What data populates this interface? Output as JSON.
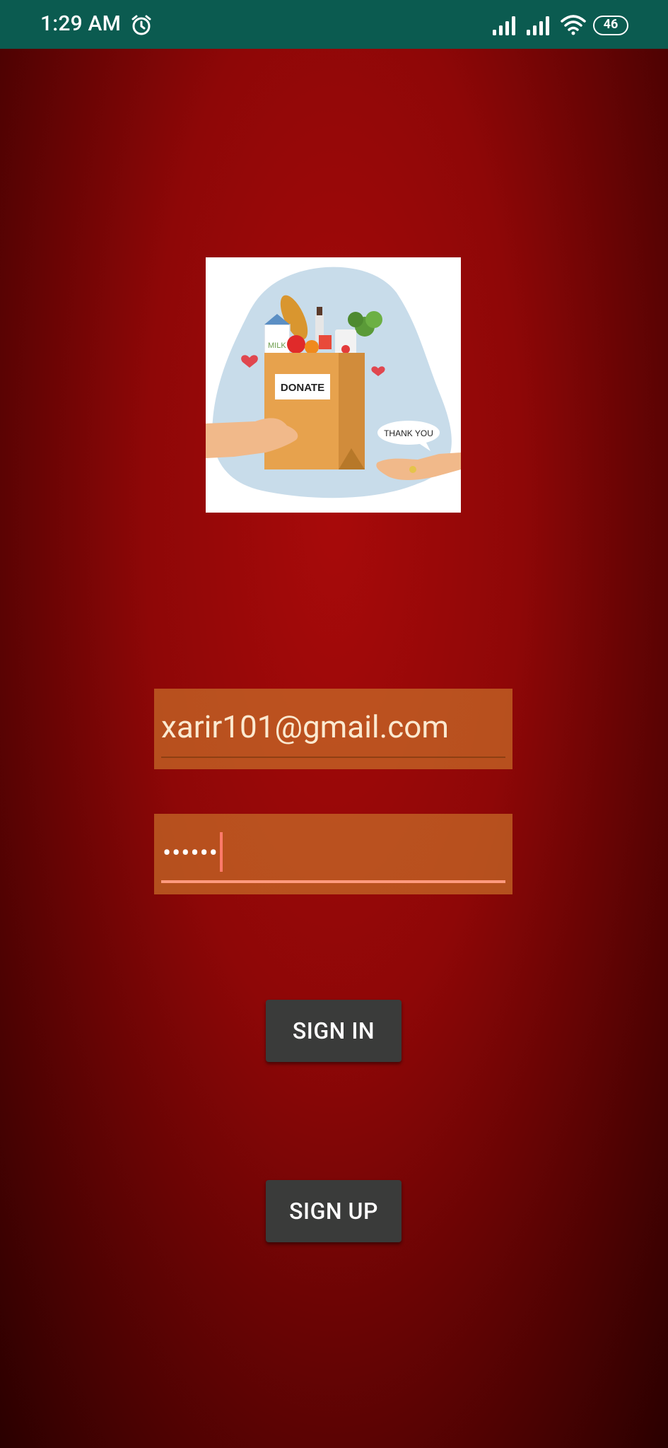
{
  "status_bar": {
    "time": "1:29 AM",
    "battery": "46",
    "icons": [
      "alarm-icon",
      "signal-icon",
      "signal-icon",
      "wifi-icon",
      "battery-icon"
    ]
  },
  "logo": {
    "icon": "donation-illustration",
    "bag_label": "DONATE",
    "speech_bubble": "THANK YOU",
    "milk_label": "MILK"
  },
  "login_form": {
    "email_value": "xarir101@gmail.com",
    "password_masked": "••••••"
  },
  "buttons": {
    "sign_in_label": "SIGN IN",
    "sign_up_label": "SIGN UP"
  },
  "colors": {
    "status_bar": "#0b5b50",
    "background": "#8e0707",
    "field_background": "#c86e28",
    "button": "#3a3b3a",
    "focus_accent": "#ff9a7e"
  }
}
